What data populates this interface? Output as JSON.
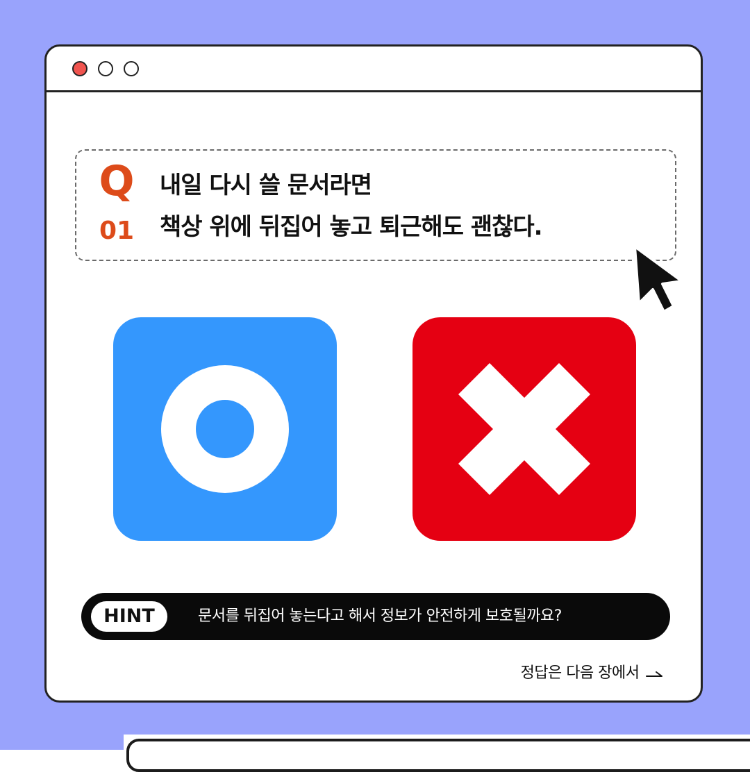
{
  "colors": {
    "background": "#99a3fc",
    "accent_orange": "#dd4b1a",
    "o_tile": "#3497fd",
    "x_tile": "#e50012",
    "window_dot_red": "#f0544f"
  },
  "window": {
    "controls": [
      "close-dot",
      "minimize-dot",
      "maximize-dot"
    ]
  },
  "question": {
    "label": "Q",
    "number": "01",
    "line1": "내일 다시 쓸 문서라면",
    "line2": "책상 위에 뒤집어 놓고 퇴근해도 괜찮다."
  },
  "answers": {
    "o_icon": "circle-o-icon",
    "x_icon": "cross-x-icon"
  },
  "hint": {
    "label": "HINT",
    "text": "문서를 뒤집어 놓는다고 해서 정보가 안전하게 보호될까요?"
  },
  "footer": {
    "next_text": "정답은 다음 장에서"
  }
}
